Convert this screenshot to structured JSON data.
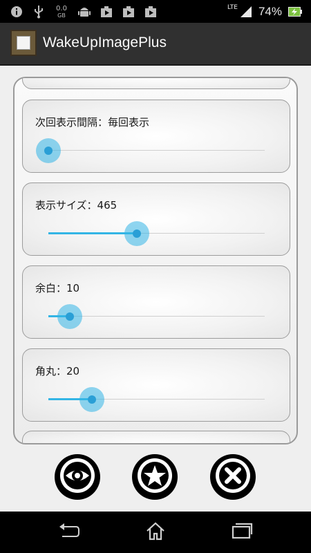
{
  "status_bar": {
    "icons_left": [
      "info-icon",
      "usb-icon",
      "data-speed-icon",
      "android-icon",
      "play-store-icon",
      "play-store-icon",
      "play-store-icon"
    ],
    "data_speed_top": "0.0",
    "data_speed_bottom": "GB",
    "network_label": "LTE",
    "battery_percent": "74%"
  },
  "action_bar": {
    "app_title": "WakeUpImagePlus",
    "app_icon": "picture-frame-icon"
  },
  "settings": [
    {
      "label": "次回表示間隔：毎回表示",
      "slider_value": 0.0
    },
    {
      "label": "表示サイズ：465",
      "slider_value": 0.41
    },
    {
      "label": "余白：10",
      "slider_value": 0.1
    },
    {
      "label": "角丸：20",
      "slider_value": 0.2
    }
  ],
  "buttons": {
    "preview": "eye-icon",
    "favorite": "star-icon",
    "close": "close-icon"
  },
  "nav_bar": {
    "back": "back-icon",
    "home": "home-icon",
    "recents": "recents-icon"
  },
  "colors": {
    "accent": "#33b5e5",
    "action_bar": "#303030"
  }
}
